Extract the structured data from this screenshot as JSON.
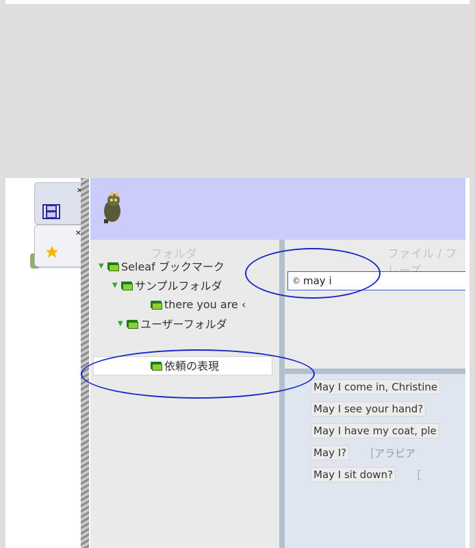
{
  "tabs": [
    {
      "name": "film-tab",
      "close": "×"
    },
    {
      "name": "star-tab",
      "close": "×"
    }
  ],
  "folder_pane": {
    "title": "フォルダ",
    "nodes": [
      {
        "label": "Seleaf ブックマーク",
        "expanded": true
      },
      {
        "label": "サンプルフォルダ",
        "expanded": true
      },
      {
        "label": "there you are ‹",
        "expanded": false
      },
      {
        "label": "ユーザーフォルダ",
        "expanded": true
      },
      {
        "label": "依頼の表現",
        "expanded": false,
        "selected": true
      }
    ],
    "caret": "▼"
  },
  "phrase_pane": {
    "title": "ファイル / フレーズ",
    "search_value": "may i",
    "search_icon": "©"
  },
  "results": [
    {
      "en": "May I come in, Christine",
      "jp": ""
    },
    {
      "en": "May I see your hand?",
      "jp": ""
    },
    {
      "en": "May I have my coat, ple",
      "jp": ""
    },
    {
      "en": "May I?",
      "jp": "［アラビア"
    },
    {
      "en": "May I sit down?",
      "jp": "［"
    }
  ],
  "colors": {
    "toolbar": "#ccccfb",
    "highlight": "#1626c8",
    "folder_green": "#8cd12e"
  }
}
